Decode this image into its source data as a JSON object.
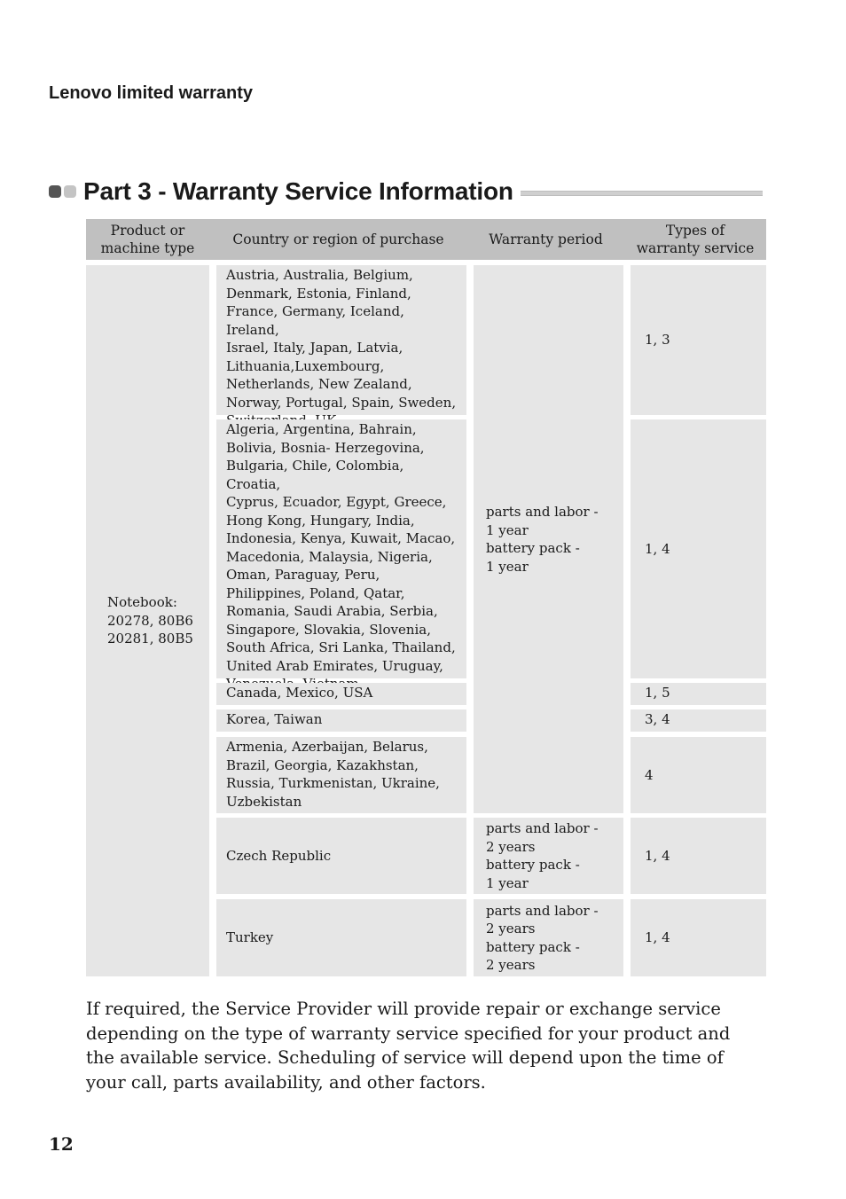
{
  "running_head": "Lenovo limited warranty",
  "section_title": "Part 3 - Warranty Service Information",
  "table": {
    "headers": [
      "Product or\nmachine type",
      "Country or region of purchase",
      "Warranty period",
      "Types of\nwarranty service"
    ],
    "product": "Notebook:\n20278, 80B6\n20281, 80B5",
    "rows": [
      {
        "countries": "Austria, Australia, Belgium,\nDenmark, Estonia, Finland,\nFrance, Germany, Iceland, Ireland,\nIsrael, Italy, Japan, Latvia,\nLithuania,Luxembourg,\nNetherlands, New Zealand,\nNorway, Portugal, Spain, Sweden,\nSwitzerland, UK",
        "service_types": "1, 3"
      },
      {
        "countries": "Algeria, Argentina, Bahrain,\nBolivia, Bosnia- Herzegovina,\nBulgaria, Chile, Colombia, Croatia,\nCyprus, Ecuador, Egypt, Greece,\nHong Kong, Hungary, India,\nIndonesia, Kenya, Kuwait, Macao,\nMacedonia, Malaysia, Nigeria,\nOman, Paraguay, Peru,\nPhilippines, Poland, Qatar,\nRomania, Saudi Arabia, Serbia,\nSingapore, Slovakia, Slovenia,\nSouth Africa, Sri Lanka, Thailand,\nUnited Arab Emirates, Uruguay,\nVenezuela, Vietnam",
        "service_types": "1, 4"
      },
      {
        "countries": "Canada, Mexico, USA",
        "service_types": "1, 5"
      },
      {
        "countries": "Korea, Taiwan",
        "service_types": "3, 4"
      },
      {
        "countries": "Armenia, Azerbaijan, Belarus,\nBrazil, Georgia, Kazakhstan,\nRussia, Turkmenistan, Ukraine,\nUzbekistan",
        "service_types": "4"
      },
      {
        "countries": "Czech Republic",
        "warranty_period": "parts and labor -\n2 years\nbattery pack -\n1 year",
        "service_types": "1, 4"
      },
      {
        "countries": "Turkey",
        "warranty_period": "parts and labor -\n2 years\nbattery pack -\n2 years",
        "service_types": "1, 4"
      }
    ],
    "shared_warranty_period": "parts and labor -\n1 year\nbattery pack -\n1 year"
  },
  "paragraph": "If required, the Service Provider will provide repair or exchange service depending on the type of warranty service specified for your product and the available service. Scheduling of service will depend upon the time of your call, parts availability, and other factors.",
  "page_number": "12"
}
